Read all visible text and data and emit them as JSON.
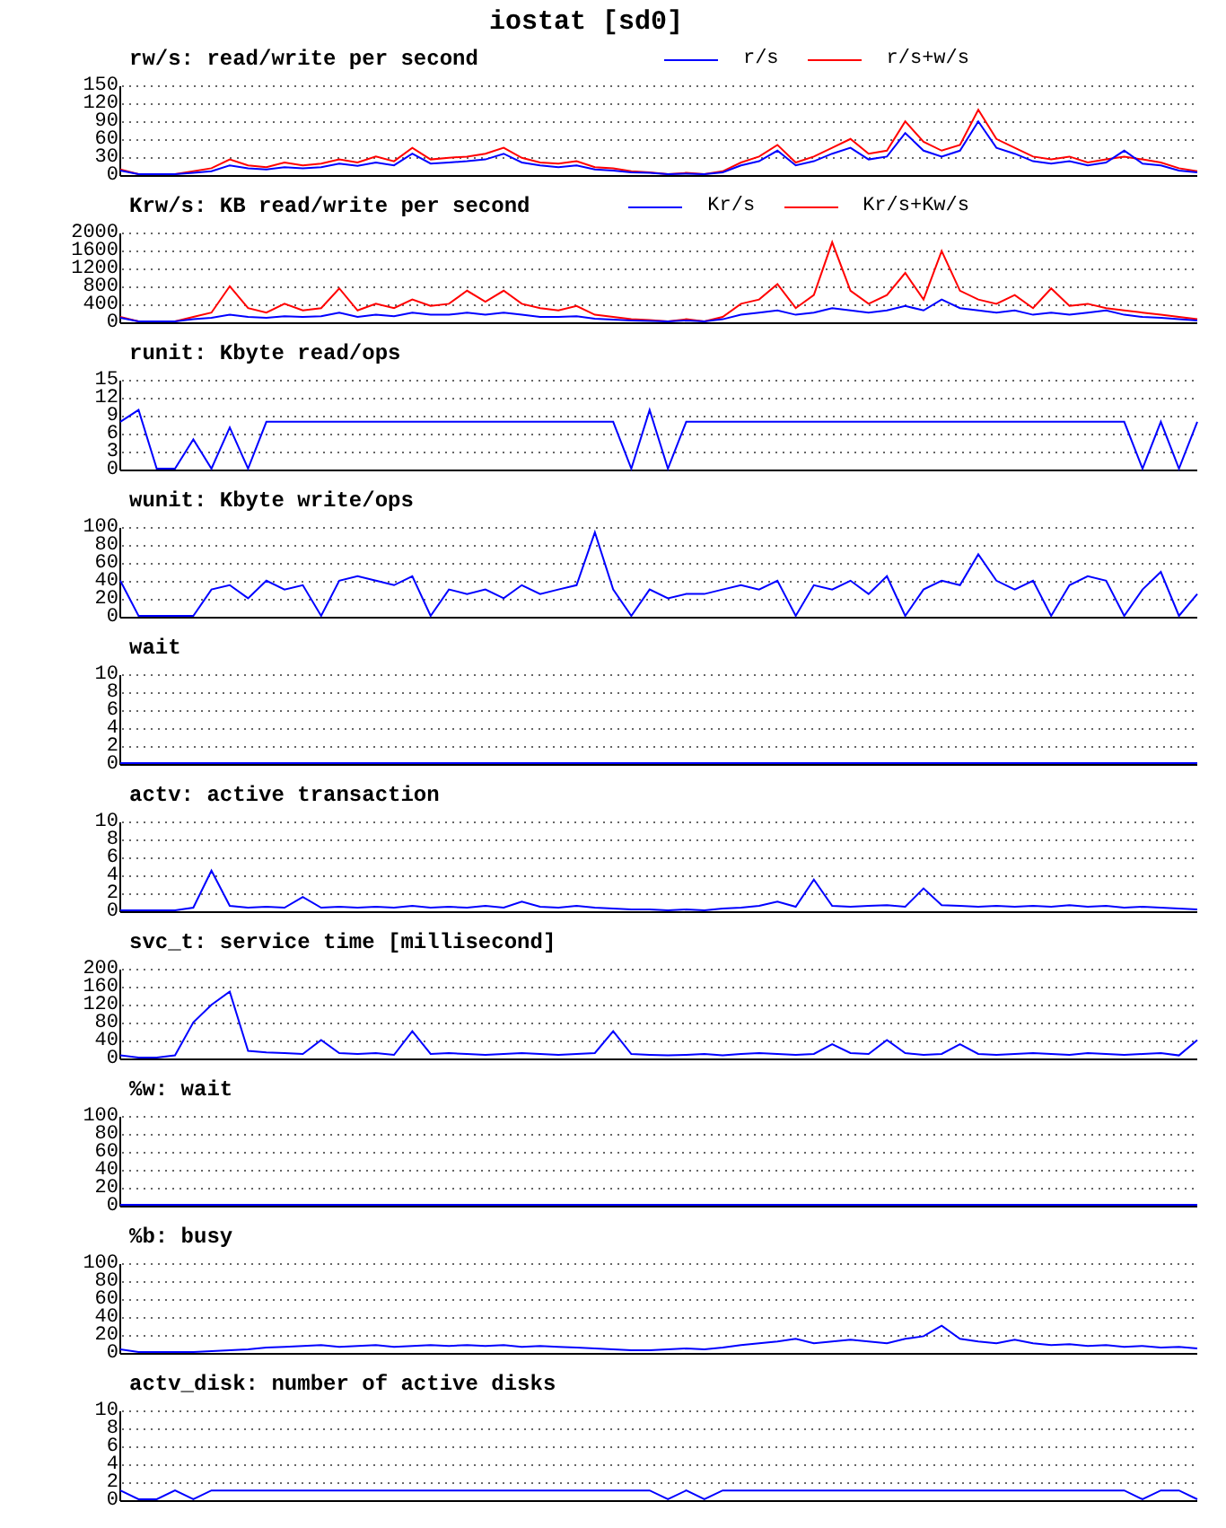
{
  "title": "iostat [sd0]",
  "panels": [
    {
      "chart_data": {
        "type": "line",
        "title": "rw/s: read/write per second",
        "legend": "top",
        "grid": true,
        "ylim": [
          0,
          150
        ],
        "yticks": [
          150,
          120,
          90,
          60,
          30,
          0
        ],
        "series": [
          {
            "name": "r/s",
            "color": "#0000ff",
            "values": [
              6,
              0,
              0,
              0,
              2,
              5,
              15,
              10,
              8,
              12,
              10,
              12,
              18,
              14,
              20,
              15,
              35,
              18,
              20,
              22,
              25,
              35,
              20,
              15,
              12,
              15,
              8,
              6,
              3,
              2,
              0,
              1,
              0,
              3,
              15,
              22,
              40,
              15,
              22,
              35,
              45,
              25,
              30,
              70,
              40,
              30,
              40,
              90,
              45,
              35,
              22,
              18,
              22,
              15,
              20,
              40,
              18,
              15,
              6,
              3
            ]
          },
          {
            "name": "r/s+w/s",
            "color": "#ff0000",
            "values": [
              8,
              0,
              0,
              0,
              5,
              10,
              25,
              15,
              12,
              20,
              15,
              18,
              25,
              20,
              30,
              22,
              45,
              25,
              28,
              30,
              35,
              45,
              28,
              20,
              18,
              22,
              12,
              10,
              5,
              3,
              0,
              2,
              0,
              5,
              20,
              30,
              50,
              20,
              30,
              45,
              60,
              35,
              40,
              90,
              55,
              40,
              50,
              110,
              60,
              45,
              30,
              25,
              30,
              20,
              25,
              30,
              25,
              20,
              10,
              5
            ]
          }
        ]
      }
    },
    {
      "chart_data": {
        "type": "line",
        "title": "Krw/s: KB read/write per second",
        "legend": "top",
        "grid": true,
        "ylim": [
          0,
          2000
        ],
        "yticks": [
          2000,
          1600,
          1200,
          800,
          400,
          0
        ],
        "series": [
          {
            "name": "Kr/s",
            "color": "#0000ff",
            "values": [
              80,
              0,
              0,
              0,
              50,
              80,
              150,
              100,
              80,
              120,
              100,
              120,
              200,
              100,
              150,
              120,
              200,
              150,
              150,
              200,
              150,
              200,
              150,
              100,
              100,
              120,
              60,
              40,
              20,
              10,
              0,
              20,
              0,
              50,
              150,
              200,
              250,
              150,
              200,
              300,
              250,
              200,
              250,
              350,
              250,
              500,
              300,
              250,
              200,
              250,
              150,
              200,
              150,
              200,
              250,
              150,
              100,
              80,
              50,
              20
            ]
          },
          {
            "name": "Kr/s+Kw/s",
            "color": "#ff0000",
            "values": [
              100,
              0,
              0,
              0,
              100,
              200,
              800,
              300,
              200,
              400,
              250,
              300,
              750,
              250,
              400,
              300,
              500,
              350,
              400,
              700,
              450,
              700,
              400,
              300,
              250,
              350,
              150,
              100,
              50,
              30,
              0,
              50,
              0,
              100,
              400,
              500,
              850,
              300,
              600,
              1800,
              700,
              400,
              600,
              1100,
              500,
              1600,
              700,
              500,
              400,
              600,
              300,
              750,
              350,
              400,
              300,
              250,
              200,
              150,
              100,
              50
            ]
          }
        ]
      }
    },
    {
      "chart_data": {
        "type": "line",
        "title": "runit: Kbyte read/ops",
        "grid": true,
        "ylim": [
          0,
          15
        ],
        "yticks": [
          15,
          12,
          9,
          6,
          3,
          0
        ],
        "series": [
          {
            "color": "#0000ff",
            "values": [
              8,
              10,
              0,
              0,
              5,
              0,
              7,
              0,
              8,
              8,
              8,
              8,
              8,
              8,
              8,
              8,
              8,
              8,
              8,
              8,
              8,
              8,
              8,
              8,
              8,
              8,
              8,
              8,
              0,
              10,
              0,
              8,
              8,
              8,
              8,
              8,
              8,
              8,
              8,
              8,
              8,
              8,
              8,
              8,
              8,
              8,
              8,
              8,
              8,
              8,
              8,
              8,
              8,
              8,
              8,
              8,
              0,
              8,
              0,
              8
            ]
          }
        ]
      }
    },
    {
      "chart_data": {
        "type": "line",
        "title": "wunit: Kbyte write/ops",
        "grid": true,
        "ylim": [
          0,
          100
        ],
        "yticks": [
          100,
          80,
          60,
          40,
          20,
          0
        ],
        "series": [
          {
            "color": "#0000ff",
            "values": [
              40,
              0,
              0,
              0,
              0,
              30,
              35,
              20,
              40,
              30,
              35,
              0,
              40,
              45,
              40,
              35,
              45,
              0,
              30,
              25,
              30,
              20,
              35,
              25,
              30,
              35,
              95,
              30,
              0,
              30,
              20,
              25,
              25,
              30,
              35,
              30,
              40,
              0,
              35,
              30,
              40,
              25,
              45,
              0,
              30,
              40,
              35,
              70,
              40,
              30,
              40,
              0,
              35,
              45,
              40,
              0,
              30,
              50,
              0,
              25
            ]
          }
        ]
      }
    },
    {
      "chart_data": {
        "type": "line",
        "title": "wait",
        "grid": true,
        "ylim": [
          0,
          10
        ],
        "yticks": [
          10,
          8,
          6,
          4,
          2,
          0
        ],
        "series": [
          {
            "color": "#0000ff",
            "values": [
              0,
              0,
              0,
              0,
              0,
              0,
              0,
              0,
              0,
              0,
              0,
              0,
              0,
              0,
              0,
              0,
              0,
              0,
              0,
              0,
              0,
              0,
              0,
              0,
              0,
              0,
              0,
              0,
              0,
              0,
              0,
              0,
              0,
              0,
              0,
              0,
              0,
              0,
              0,
              0,
              0,
              0,
              0,
              0,
              0,
              0,
              0,
              0,
              0,
              0,
              0,
              0,
              0,
              0,
              0,
              0,
              0,
              0,
              0,
              0
            ]
          }
        ]
      }
    },
    {
      "chart_data": {
        "type": "line",
        "title": "actv: active transaction",
        "grid": true,
        "ylim": [
          0,
          10
        ],
        "yticks": [
          10,
          8,
          6,
          4,
          2,
          0
        ],
        "series": [
          {
            "color": "#0000ff",
            "values": [
              0,
              0,
              0,
              0,
              0.3,
              4.5,
              0.5,
              0.3,
              0.4,
              0.3,
              1.5,
              0.3,
              0.4,
              0.3,
              0.4,
              0.3,
              0.5,
              0.3,
              0.4,
              0.3,
              0.5,
              0.3,
              1,
              0.4,
              0.3,
              0.5,
              0.3,
              0.2,
              0.1,
              0.1,
              0,
              0.1,
              0,
              0.2,
              0.3,
              0.5,
              1,
              0.4,
              3.5,
              0.5,
              0.4,
              0.5,
              0.6,
              0.4,
              2.5,
              0.6,
              0.5,
              0.4,
              0.5,
              0.4,
              0.5,
              0.4,
              0.6,
              0.4,
              0.5,
              0.3,
              0.4,
              0.3,
              0.2,
              0.1
            ]
          }
        ]
      }
    },
    {
      "chart_data": {
        "type": "line",
        "title": "svc_t: service time [millisecond]",
        "grid": true,
        "ylim": [
          0,
          200
        ],
        "yticks": [
          200,
          160,
          120,
          80,
          40,
          0
        ],
        "series": [
          {
            "color": "#0000ff",
            "values": [
              5,
              0,
              0,
              5,
              80,
              120,
              150,
              15,
              12,
              10,
              8,
              40,
              10,
              8,
              10,
              6,
              60,
              8,
              10,
              8,
              6,
              8,
              10,
              8,
              6,
              8,
              10,
              60,
              8,
              6,
              5,
              6,
              8,
              5,
              8,
              10,
              8,
              6,
              8,
              30,
              10,
              8,
              40,
              10,
              6,
              8,
              30,
              8,
              6,
              8,
              10,
              8,
              6,
              10,
              8,
              6,
              8,
              10,
              5,
              40
            ]
          }
        ]
      }
    },
    {
      "chart_data": {
        "type": "line",
        "title": "%w: wait",
        "grid": true,
        "ylim": [
          0,
          100
        ],
        "yticks": [
          100,
          80,
          60,
          40,
          20,
          0
        ],
        "series": [
          {
            "color": "#0000ff",
            "values": [
              0,
              0,
              0,
              0,
              0,
              0,
              0,
              0,
              0,
              0,
              0,
              0,
              0,
              0,
              0,
              0,
              0,
              0,
              0,
              0,
              0,
              0,
              0,
              0,
              0,
              0,
              0,
              0,
              0,
              0,
              0,
              0,
              0,
              0,
              0,
              0,
              0,
              0,
              0,
              0,
              0,
              0,
              0,
              0,
              0,
              0,
              0,
              0,
              0,
              0,
              0,
              0,
              0,
              0,
              0,
              0,
              0,
              0,
              0,
              0
            ]
          }
        ]
      }
    },
    {
      "chart_data": {
        "type": "line",
        "title": "%b: busy",
        "grid": true,
        "ylim": [
          0,
          100
        ],
        "yticks": [
          100,
          80,
          60,
          40,
          20,
          0
        ],
        "series": [
          {
            "color": "#0000ff",
            "values": [
              3,
              0,
              0,
              0,
              0,
              1,
              2,
              3,
              5,
              6,
              7,
              8,
              6,
              7,
              8,
              6,
              7,
              8,
              7,
              8,
              7,
              8,
              6,
              7,
              6,
              5,
              4,
              3,
              2,
              2,
              3,
              4,
              3,
              5,
              8,
              10,
              12,
              15,
              10,
              12,
              14,
              12,
              10,
              15,
              18,
              30,
              15,
              12,
              10,
              14,
              10,
              8,
              9,
              7,
              8,
              6,
              7,
              5,
              6,
              4
            ]
          }
        ]
      }
    },
    {
      "chart_data": {
        "type": "line",
        "title": "actv_disk: number of active disks",
        "grid": true,
        "ylim": [
          0,
          10
        ],
        "yticks": [
          10,
          8,
          6,
          4,
          2,
          0
        ],
        "series": [
          {
            "color": "#0000ff",
            "values": [
              1,
              0,
              0,
              1,
              0,
              1,
              1,
              1,
              1,
              1,
              1,
              1,
              1,
              1,
              1,
              1,
              1,
              1,
              1,
              1,
              1,
              1,
              1,
              1,
              1,
              1,
              1,
              1,
              1,
              1,
              0,
              1,
              0,
              1,
              1,
              1,
              1,
              1,
              1,
              1,
              1,
              1,
              1,
              1,
              1,
              1,
              1,
              1,
              1,
              1,
              1,
              1,
              1,
              1,
              1,
              1,
              0,
              1,
              1,
              0
            ]
          }
        ]
      }
    }
  ]
}
